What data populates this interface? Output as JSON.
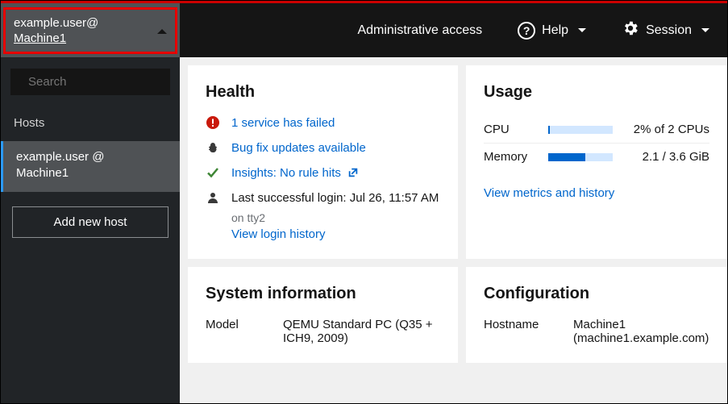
{
  "topbar": {
    "user_line": "example.user@",
    "machine": "Machine1",
    "admin_access": "Administrative access",
    "help": "Help",
    "session": "Session"
  },
  "sidebar": {
    "search_placeholder": "Search",
    "hosts_label": "Hosts",
    "host_user": "example.user @",
    "host_machine": "Machine1",
    "add_host": "Add new host"
  },
  "health": {
    "title": "Health",
    "service_failed": "1 service has failed",
    "bug_updates": "Bug fix updates available",
    "insights": "Insights: No rule hits",
    "last_login": "Last successful login: Jul 26, 11:57 AM",
    "tty": "on tty2",
    "login_history": "View login history"
  },
  "usage": {
    "title": "Usage",
    "cpu_label": "CPU",
    "cpu_text": "2% of 2 CPUs",
    "cpu_pct": 2,
    "mem_label": "Memory",
    "mem_text": "2.1 / 3.6 GiB",
    "mem_pct": 58,
    "metrics_link": "View metrics and history"
  },
  "sysinfo": {
    "title": "System information",
    "model_k": "Model",
    "model_v": "QEMU Standard PC (Q35 + ICH9, 2009)"
  },
  "config": {
    "title": "Configuration",
    "hostname_k": "Hostname",
    "hostname_v": "Machine1 (machine1.example.com)"
  }
}
